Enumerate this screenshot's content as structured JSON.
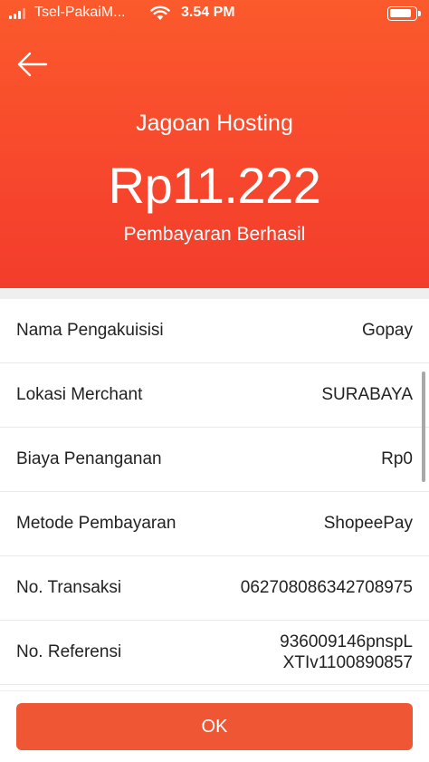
{
  "status_bar": {
    "carrier": "Tsel-PakaiM...",
    "time": "3.54 PM",
    "battery_level": 0.9
  },
  "header": {
    "merchant_name": "Jagoan Hosting",
    "amount": "Rp11.222",
    "payment_status": "Pembayaran Berhasil",
    "accent_color": "#f7472d"
  },
  "details": [
    {
      "label": "Nama Pengakuisisi",
      "value": "Gopay"
    },
    {
      "label": "Lokasi Merchant",
      "value": "SURABAYA"
    },
    {
      "label": "Biaya Penanganan",
      "value": "Rp0"
    },
    {
      "label": "Metode Pembayaran",
      "value": "ShopeePay"
    },
    {
      "label": "No. Transaksi",
      "value": "062708086342708975"
    },
    {
      "label": "No. Referensi",
      "value_line1": "936009146pnspL",
      "value_line2": "XTIv1100890857"
    }
  ],
  "footer": {
    "ok_label": "OK",
    "button_color": "#ef5734"
  }
}
